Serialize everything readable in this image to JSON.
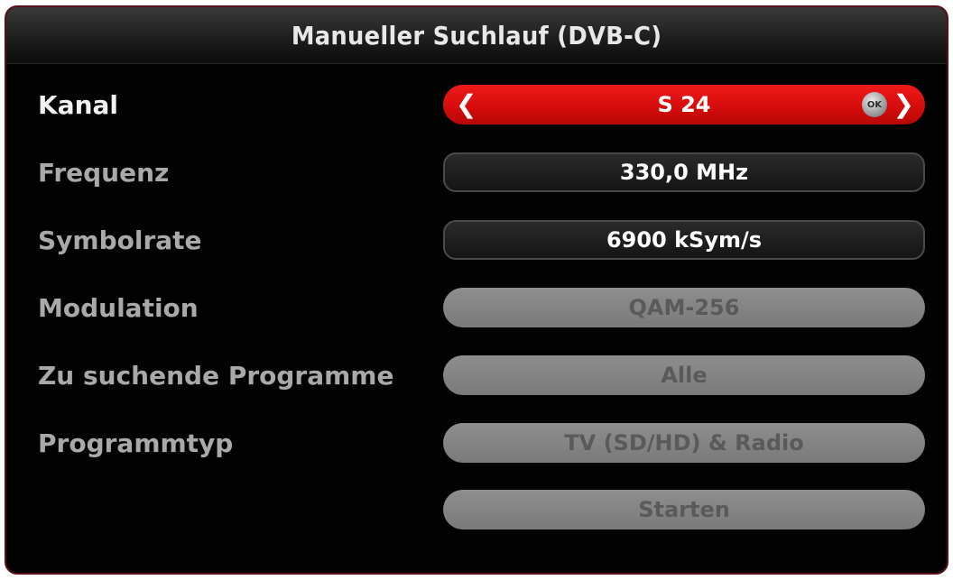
{
  "window": {
    "title": "Manueller Suchlauf (DVB-C)"
  },
  "rows": [
    {
      "label": "Kanal",
      "value": "S 24",
      "ok_badge": "OK"
    },
    {
      "label": "Frequenz",
      "value": "330,0 MHz"
    },
    {
      "label": "Symbolrate",
      "value": "6900 kSym/s"
    },
    {
      "label": "Modulation",
      "value": "QAM-256"
    },
    {
      "label": "Zu suchende Programme",
      "value": "Alle"
    },
    {
      "label": "Programmtyp",
      "value": "TV (SD/HD) & Radio"
    }
  ],
  "start_button": {
    "label": "Starten"
  },
  "colors": {
    "selected": "#e01010",
    "disabled": "#858585",
    "background": "#020202"
  },
  "icons": {
    "left_arrow": "chevron-left-icon",
    "right_arrow": "chevron-right-icon",
    "ok_button": "ok-button-icon"
  }
}
